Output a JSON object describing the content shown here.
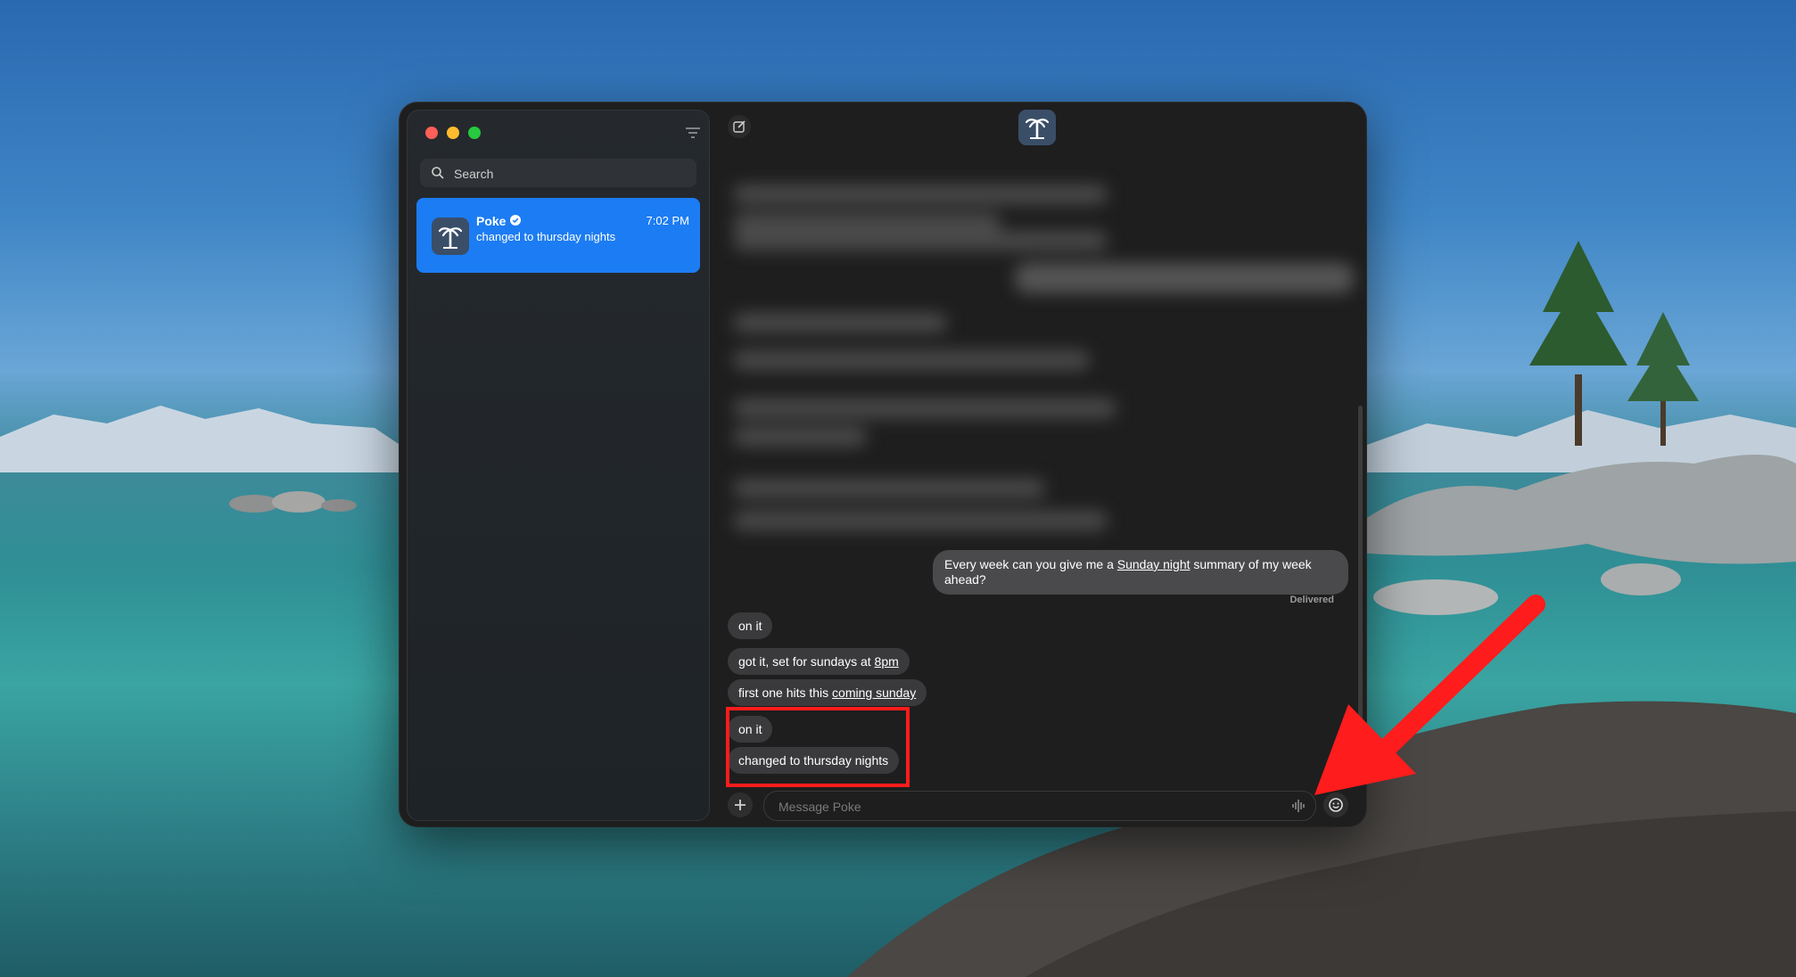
{
  "sidebar": {
    "search_placeholder": "Search",
    "conversations": [
      {
        "name": "Poke",
        "time": "7:02 PM",
        "preview": "changed to thursday nights"
      }
    ]
  },
  "chat": {
    "outgoing": {
      "pre": "Every week can you give me a ",
      "link": "Sunday night",
      "post": " summary of my week ahead?",
      "status": "Delivered"
    },
    "incoming": [
      {
        "text": "on it"
      },
      {
        "pre": "got it, set for sundays at ",
        "link": "8pm"
      },
      {
        "pre": "first one hits this ",
        "link": "coming sunday"
      },
      {
        "text": "on it"
      },
      {
        "text": "changed to thursday nights"
      }
    ],
    "composer_placeholder": "Message Poke"
  },
  "colors": {
    "accent": "#1c7cf3",
    "annotation": "#ff1c1c"
  }
}
